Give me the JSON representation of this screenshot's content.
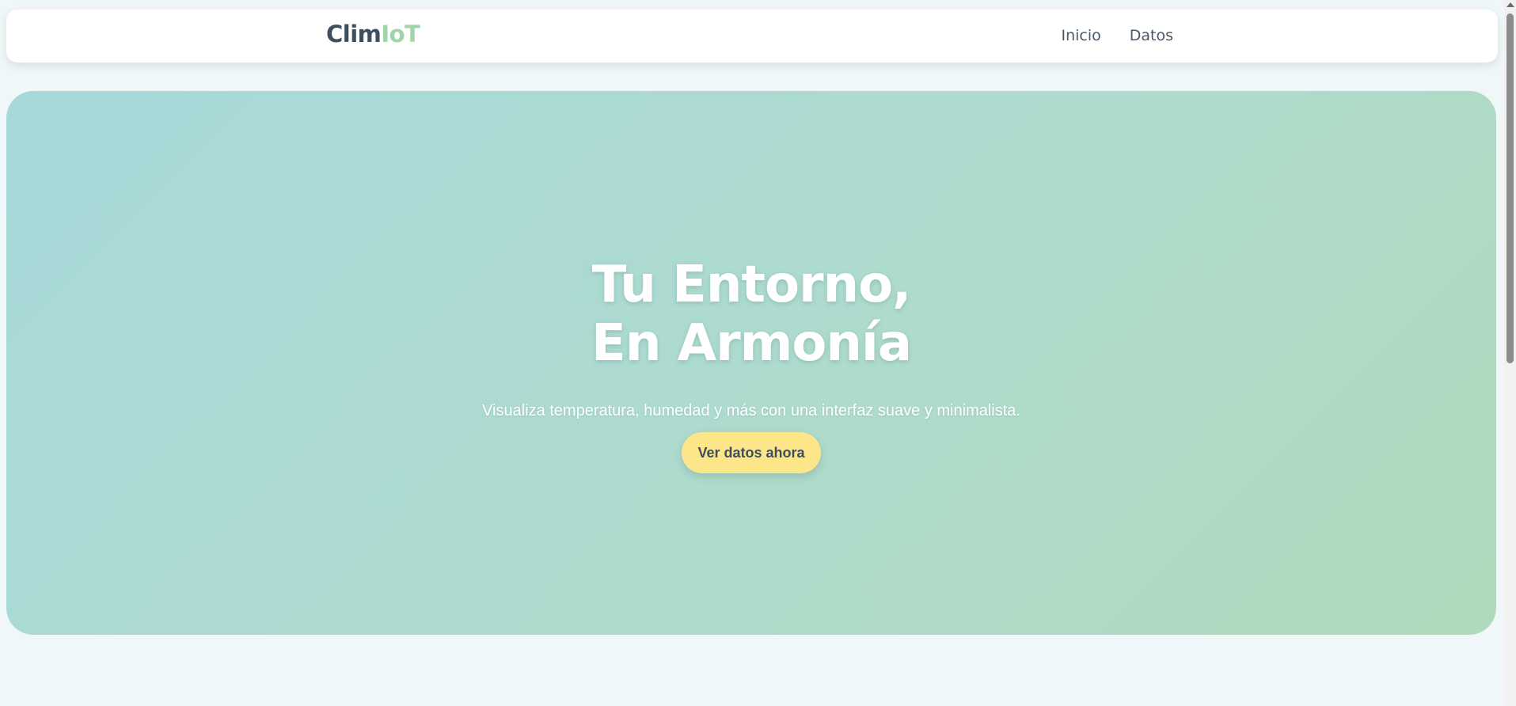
{
  "navbar": {
    "logo_primary": "Clim",
    "logo_accent": "IoT",
    "links": [
      "Inicio",
      "Datos"
    ]
  },
  "hero": {
    "title_line1": "Tu Entorno,",
    "title_line2": "En Armonía",
    "subtitle": "Visualiza temperatura, humedad y más con una interfaz suave y minimalista.",
    "cta_label": "Ver datos ahora"
  },
  "colors": {
    "brand_dark": "#3d4e5e",
    "brand_accent": "#9fd5a9",
    "cta_background": "#fde68a",
    "hero_gradient_start": "#a7d9db",
    "hero_gradient_end": "#b0dabb",
    "page_background": "#eff7f8"
  }
}
